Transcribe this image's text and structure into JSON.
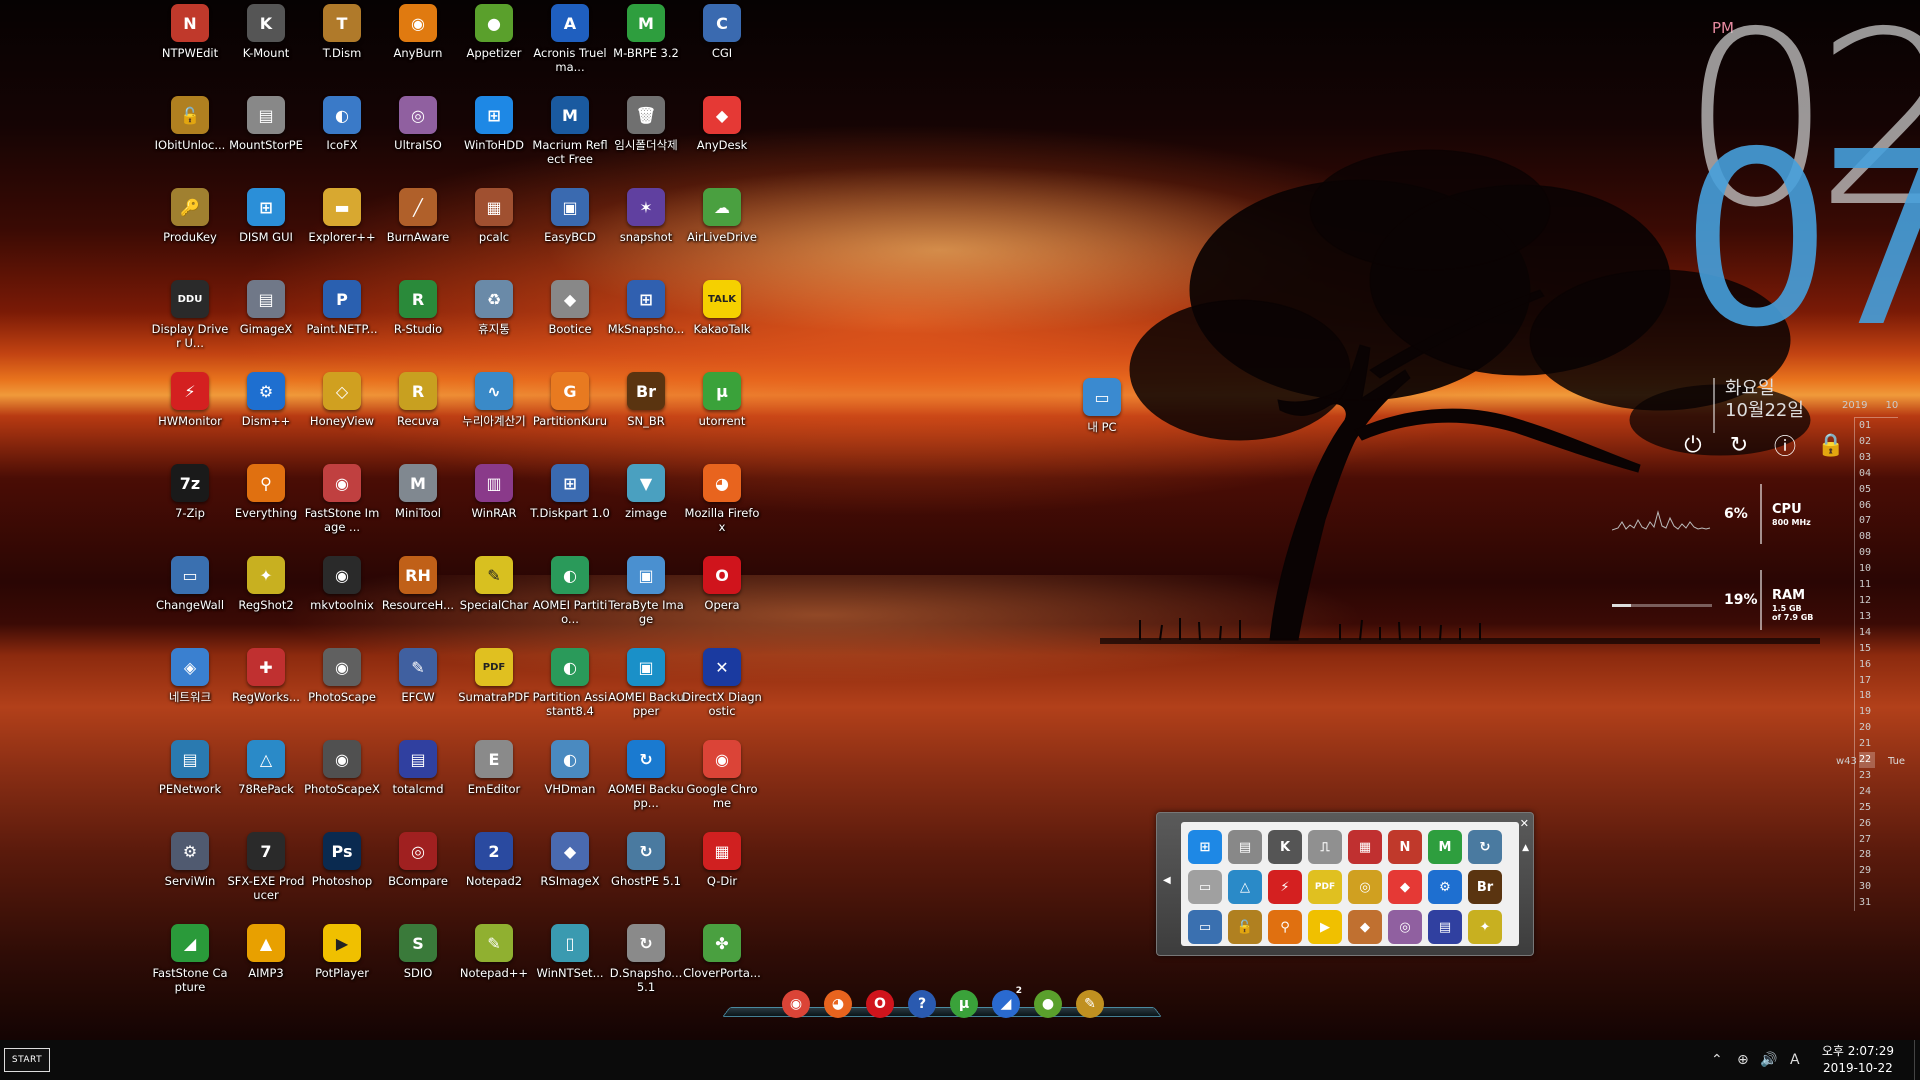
{
  "desktop": {
    "icons": [
      {
        "label": "NTPWEdit",
        "glyph": "N",
        "color": "#c0392b",
        "icon": "ntpwedit-icon"
      },
      {
        "label": "K-Mount",
        "glyph": "K",
        "color": "#555555",
        "icon": "k-mount-icon"
      },
      {
        "label": "T.Dism",
        "glyph": "T",
        "color": "#b07a2a",
        "icon": "tdism-icon"
      },
      {
        "label": "AnyBurn",
        "glyph": "◉",
        "color": "#e07a10",
        "icon": "anyburn-icon"
      },
      {
        "label": "Appetizer",
        "glyph": "●",
        "color": "#5aa02c",
        "icon": "appetizer-icon"
      },
      {
        "label": "Acronis Truelma...",
        "glyph": "A",
        "color": "#1f5fbf",
        "icon": "acronis-icon"
      },
      {
        "label": "M-BRPE 3.2",
        "glyph": "M",
        "color": "#2e9e3e",
        "icon": "mbrpe-icon"
      },
      {
        "label": "CGI",
        "glyph": "C",
        "color": "#3a6ab0",
        "icon": "cgi-icon"
      },
      {
        "label": "IObitUnloc...",
        "glyph": "🔓",
        "color": "#b08020",
        "icon": "iobit-unlocker-icon"
      },
      {
        "label": "MountStorPE",
        "glyph": "▤",
        "color": "#888888",
        "icon": "mountstorpe-icon"
      },
      {
        "label": "IcoFX",
        "glyph": "◐",
        "color": "#3a7ac8",
        "icon": "icofx-icon"
      },
      {
        "label": "UltraISO",
        "glyph": "◎",
        "color": "#9060a0",
        "icon": "ultraiso-icon"
      },
      {
        "label": "WinToHDD",
        "glyph": "⊞",
        "color": "#1e88e5",
        "icon": "wintohdd-icon"
      },
      {
        "label": "Macrium Reflect Free",
        "glyph": "M",
        "color": "#1a5aa0",
        "icon": "macrium-icon"
      },
      {
        "label": "임시폴더삭제",
        "glyph": "🗑",
        "color": "#707070",
        "icon": "trash-icon"
      },
      {
        "label": "AnyDesk",
        "glyph": "◆",
        "color": "#e53935",
        "icon": "anydesk-icon"
      },
      {
        "label": "ProduKey",
        "glyph": "🔑",
        "color": "#a08030",
        "icon": "produkey-icon"
      },
      {
        "label": "DISM GUI",
        "glyph": "⊞",
        "color": "#2b8fd8",
        "icon": "dism-gui-icon"
      },
      {
        "label": "Explorer++",
        "glyph": "▬",
        "color": "#d8a830",
        "icon": "explorer-plus-icon"
      },
      {
        "label": "BurnAware",
        "glyph": "╱",
        "color": "#b0602a",
        "icon": "burnaware-icon"
      },
      {
        "label": "pcalc",
        "glyph": "▦",
        "color": "#a05030",
        "icon": "pcalc-icon"
      },
      {
        "label": "EasyBCD",
        "glyph": "▣",
        "color": "#3a6ab0",
        "icon": "easybcd-icon"
      },
      {
        "label": "snapshot",
        "glyph": "✶",
        "color": "#6040a0",
        "icon": "snapshot-icon"
      },
      {
        "label": "AirLiveDrive",
        "glyph": "☁",
        "color": "#4aa040",
        "icon": "airlivedrive-icon"
      },
      {
        "label": "Display Driver U...",
        "glyph": "DDU",
        "color": "#2a2a2a",
        "icon": "ddu-icon"
      },
      {
        "label": "GimageX",
        "glyph": "▤",
        "color": "#707888",
        "icon": "gimagex-icon"
      },
      {
        "label": "Paint.NETP...",
        "glyph": "P",
        "color": "#2a60b0",
        "icon": "paintnet-icon"
      },
      {
        "label": "R-Studio",
        "glyph": "R",
        "color": "#2a8a3a",
        "icon": "r-studio-icon"
      },
      {
        "label": "휴지통",
        "glyph": "♻",
        "color": "#6a8aa8",
        "icon": "recycle-bin-icon"
      },
      {
        "label": "Bootice",
        "glyph": "◆",
        "color": "#888888",
        "icon": "bootice-icon"
      },
      {
        "label": "MkSnapsho...",
        "glyph": "⊞",
        "color": "#3060b0",
        "icon": "mksnapshot-icon"
      },
      {
        "label": "KakaoTalk",
        "glyph": "TALK",
        "color": "#f5d000",
        "icon": "kakaotalk-icon"
      },
      {
        "label": "HWMonitor",
        "glyph": "⚡",
        "color": "#d42020",
        "icon": "hwmonitor-icon"
      },
      {
        "label": "Dism++",
        "glyph": "⚙",
        "color": "#1e6fd0",
        "icon": "dism-plus-icon"
      },
      {
        "label": "HoneyView",
        "glyph": "◇",
        "color": "#d0a020",
        "icon": "honeyview-icon"
      },
      {
        "label": "Recuva",
        "glyph": "R",
        "color": "#c8a020",
        "icon": "recuva-icon"
      },
      {
        "label": "누리아계산기",
        "glyph": "∿",
        "color": "#3a8ac8",
        "icon": "nuria-calculator-icon"
      },
      {
        "label": "PartitionKuru",
        "glyph": "G",
        "color": "#e87a20",
        "icon": "partitionkuru-icon"
      },
      {
        "label": "SN_BR",
        "glyph": "Br",
        "color": "#5a3410",
        "icon": "bridge-icon"
      },
      {
        "label": "utorrent",
        "glyph": "μ",
        "color": "#3aa23a",
        "icon": "utorrent-icon"
      },
      {
        "label": "7-Zip",
        "glyph": "7z",
        "color": "#1a1a1a",
        "icon": "7zip-icon"
      },
      {
        "label": "Everything",
        "glyph": "⚲",
        "color": "#e07010",
        "icon": "everything-icon"
      },
      {
        "label": "FastStone Image ...",
        "glyph": "◉",
        "color": "#c04040",
        "icon": "faststone-icon"
      },
      {
        "label": "MiniTool",
        "glyph": "M",
        "color": "#808890",
        "icon": "minitool-icon"
      },
      {
        "label": "WinRAR",
        "glyph": "▥",
        "color": "#8a3a8a",
        "icon": "winrar-icon"
      },
      {
        "label": "T.Diskpart 1.0",
        "glyph": "⊞",
        "color": "#3a6ab0",
        "icon": "tdiskpart-icon"
      },
      {
        "label": "zimage",
        "glyph": "▼",
        "color": "#4aa0c0",
        "icon": "zimage-icon"
      },
      {
        "label": "Mozilla Firefox",
        "glyph": "◕",
        "color": "#e8641e",
        "icon": "firefox-icon"
      },
      {
        "label": "ChangeWall",
        "glyph": "▭",
        "color": "#3a70b0",
        "icon": "changewall-icon"
      },
      {
        "label": "RegShot2",
        "glyph": "✦",
        "color": "#c8b020",
        "icon": "regshot-icon"
      },
      {
        "label": "mkvtoolnix",
        "glyph": "◉",
        "color": "#2a2a2a",
        "icon": "mkvtoolnix-icon"
      },
      {
        "label": "ResourceH...",
        "glyph": "RH",
        "color": "#c06018",
        "icon": "resource-hacker-icon"
      },
      {
        "label": "SpecialChar",
        "glyph": "✎",
        "color": "#d8c020",
        "icon": "specialchar-icon"
      },
      {
        "label": "AOMEI Partitio...",
        "glyph": "◐",
        "color": "#2a9a5a",
        "icon": "aomei-partition-icon"
      },
      {
        "label": "TeraByte Image",
        "glyph": "▣",
        "color": "#4a90d0",
        "icon": "terabyte-image-icon"
      },
      {
        "label": "Opera",
        "glyph": "O",
        "color": "#d0141c",
        "icon": "opera-icon"
      },
      {
        "label": "네트워크",
        "glyph": "◈",
        "color": "#3a80d0",
        "icon": "network-icon"
      },
      {
        "label": "RegWorks...",
        "glyph": "✚",
        "color": "#c03030",
        "icon": "regworks-icon"
      },
      {
        "label": "PhotoScape",
        "glyph": "◉",
        "color": "#606060",
        "icon": "photoscape-icon"
      },
      {
        "label": "EFCW",
        "glyph": "✎",
        "color": "#4060a0",
        "icon": "efcw-icon"
      },
      {
        "label": "SumatraPDF",
        "glyph": "PDF",
        "color": "#e0c020",
        "icon": "sumatrapdf-icon"
      },
      {
        "label": "Partition Assistant8.4",
        "glyph": "◐",
        "color": "#2a9a5a",
        "icon": "partition-assistant-icon"
      },
      {
        "label": "AOMEI Backupper",
        "glyph": "▣",
        "color": "#1a90c8",
        "icon": "aomei-backupper-icon"
      },
      {
        "label": "DirectX Diagnostic",
        "glyph": "✕",
        "color": "#1a3aa0",
        "icon": "directx-icon"
      },
      {
        "label": "PENetwork",
        "glyph": "▤",
        "color": "#2a7ab0",
        "icon": "penetwork-icon"
      },
      {
        "label": "78RePack",
        "glyph": "△",
        "color": "#2a8ac8",
        "icon": "78repack-icon"
      },
      {
        "label": "PhotoScapeX",
        "glyph": "◉",
        "color": "#505050",
        "icon": "photoscapex-icon"
      },
      {
        "label": "totalcmd",
        "glyph": "▤",
        "color": "#3040a0",
        "icon": "totalcmd-icon"
      },
      {
        "label": "EmEditor",
        "glyph": "E",
        "color": "#8a8a8a",
        "icon": "emeditor-icon"
      },
      {
        "label": "VHDman",
        "glyph": "◐",
        "color": "#4a8ac0",
        "icon": "vhdman-icon"
      },
      {
        "label": "AOMEI Backupp...",
        "glyph": "↻",
        "color": "#1a7ad0",
        "icon": "aomei-backupper2-icon"
      },
      {
        "label": "Google Chrome",
        "glyph": "◉",
        "color": "#db4437",
        "icon": "chrome-icon"
      },
      {
        "label": "ServiWin",
        "glyph": "⚙",
        "color": "#505a70",
        "icon": "serviwin-icon"
      },
      {
        "label": "SFX-EXE Producer",
        "glyph": "7",
        "color": "#2a2a2a",
        "icon": "sfx-exe-icon"
      },
      {
        "label": "Photoshop",
        "glyph": "Ps",
        "color": "#0a2a50",
        "icon": "photoshop-icon"
      },
      {
        "label": "BCompare",
        "glyph": "◎",
        "color": "#a02020",
        "icon": "bcompare-icon"
      },
      {
        "label": "Notepad2",
        "glyph": "2",
        "color": "#2a4aa0",
        "icon": "notepad2-icon"
      },
      {
        "label": "RSImageX",
        "glyph": "◆",
        "color": "#4a6ab0",
        "icon": "rsimagex-icon"
      },
      {
        "label": "GhostPE 5.1",
        "glyph": "↻",
        "color": "#4a7aa0",
        "icon": "ghostpe-icon"
      },
      {
        "label": "Q-Dir",
        "glyph": "▦",
        "color": "#d02020",
        "icon": "q-dir-icon"
      },
      {
        "label": "FastStone Capture",
        "glyph": "◢",
        "color": "#2a9a3a",
        "icon": "faststone-capture-icon"
      },
      {
        "label": "AIMP3",
        "glyph": "▲",
        "color": "#e8a000",
        "icon": "aimp-icon"
      },
      {
        "label": "PotPlayer",
        "glyph": "▶",
        "color": "#f0c000",
        "icon": "potplayer-icon"
      },
      {
        "label": "SDIO",
        "glyph": "S",
        "color": "#3a7a3a",
        "icon": "sdio-icon"
      },
      {
        "label": "Notepad++",
        "glyph": "✎",
        "color": "#90b030",
        "icon": "notepad-plus-icon"
      },
      {
        "label": "WinNTSet...",
        "glyph": "▯",
        "color": "#3a9ab0",
        "icon": "winntsetup-icon"
      },
      {
        "label": "D.Snapsho... 5.1",
        "glyph": "↻",
        "color": "#8a8a8a",
        "icon": "dsnapshot-icon"
      },
      {
        "label": "CloverPorta...",
        "glyph": "✤",
        "color": "#4aa040",
        "icon": "clover-icon"
      }
    ],
    "mypc": {
      "label": "내 PC",
      "glyph": "▭",
      "color": "#3a8ad0"
    }
  },
  "clock": {
    "ampm": "PM",
    "hour": "02",
    "minute": "07",
    "weekday": "화요일",
    "date": "10월22일"
  },
  "power_buttons": [
    {
      "name": "shutdown-icon",
      "glyph": "⏻"
    },
    {
      "name": "restart-icon",
      "glyph": "↻"
    },
    {
      "name": "logoff-icon",
      "glyph": "ⓘ"
    },
    {
      "name": "lock-icon",
      "glyph": "🔒"
    }
  ],
  "meters": {
    "cpu": {
      "percent": "6%",
      "name": "CPU",
      "sub": "800 MHz",
      "level": 0.06
    },
    "ram": {
      "percent": "19%",
      "name": "RAM",
      "sub1": "1.5 GB",
      "sub2": "of 7.9 GB",
      "level": 0.19
    }
  },
  "calendar": {
    "year": "2019",
    "month": "10",
    "days": [
      "01",
      "02",
      "03",
      "04",
      "05",
      "06",
      "07",
      "08",
      "09",
      "10",
      "11",
      "12",
      "13",
      "14",
      "15",
      "16",
      "17",
      "18",
      "19",
      "20",
      "21",
      "22",
      "23",
      "24",
      "25",
      "26",
      "27",
      "28",
      "29",
      "30",
      "31"
    ],
    "today_index": 21,
    "week": "w43",
    "dow": "Tue"
  },
  "quicklaunch": {
    "items": [
      {
        "icon": "windows-icon",
        "glyph": "⊞",
        "color": "#1e88e5"
      },
      {
        "icon": "mountstorpe-icon",
        "glyph": "▤",
        "color": "#888888"
      },
      {
        "icon": "k-mount-icon",
        "glyph": "K",
        "color": "#555555"
      },
      {
        "icon": "usb-icon",
        "glyph": "⎍",
        "color": "#909090"
      },
      {
        "icon": "partition-icon",
        "glyph": "▦",
        "color": "#c03030"
      },
      {
        "icon": "ntpwedit-icon",
        "glyph": "N",
        "color": "#c0392b"
      },
      {
        "icon": "mbrpe-icon",
        "glyph": "M",
        "color": "#2e9e3e"
      },
      {
        "icon": "ghost-icon",
        "glyph": "↻",
        "color": "#4a7aa0"
      },
      {
        "icon": "drive-icon",
        "glyph": "▭",
        "color": "#a0a0a0"
      },
      {
        "icon": "78repack-icon",
        "glyph": "△",
        "color": "#2a8ac8"
      },
      {
        "icon": "hwmonitor-icon",
        "glyph": "⚡",
        "color": "#d42020"
      },
      {
        "icon": "sumatrapdf-icon",
        "glyph": "PDF",
        "color": "#e0c020"
      },
      {
        "icon": "cd-icon",
        "glyph": "◎",
        "color": "#d0a020"
      },
      {
        "icon": "anydesk-icon",
        "glyph": "◆",
        "color": "#e53935"
      },
      {
        "icon": "dism-plus-icon",
        "glyph": "⚙",
        "color": "#1e6fd0"
      },
      {
        "icon": "bridge-icon",
        "glyph": "Br",
        "color": "#5a3410"
      },
      {
        "icon": "changewall-icon",
        "glyph": "▭",
        "color": "#3a70b0"
      },
      {
        "icon": "iobit-unlocker-icon",
        "glyph": "🔓",
        "color": "#b08020"
      },
      {
        "icon": "everything-icon",
        "glyph": "⚲",
        "color": "#e07010"
      },
      {
        "icon": "potplayer-icon",
        "glyph": "▶",
        "color": "#f0c000"
      },
      {
        "icon": "box-icon",
        "glyph": "◆",
        "color": "#c07030"
      },
      {
        "icon": "ultraiso-icon",
        "glyph": "◎",
        "color": "#9060a0"
      },
      {
        "icon": "totalcmd-icon",
        "glyph": "▤",
        "color": "#3040a0"
      },
      {
        "icon": "regshot-icon",
        "glyph": "✦",
        "color": "#c8b020"
      }
    ]
  },
  "dock": {
    "items": [
      {
        "icon": "chrome-icon",
        "glyph": "◉",
        "color": "#db4437"
      },
      {
        "icon": "firefox-icon",
        "glyph": "◕",
        "color": "#e8641e"
      },
      {
        "icon": "opera-icon",
        "glyph": "O",
        "color": "#d0141c"
      },
      {
        "icon": "help-icon",
        "glyph": "?",
        "color": "#2a5ab0"
      },
      {
        "icon": "utorrent-icon",
        "glyph": "μ",
        "color": "#3aa23a"
      },
      {
        "icon": "network-signal-icon",
        "glyph": "◢",
        "color": "#2a6ad0"
      },
      {
        "icon": "appetizer-icon",
        "glyph": "●",
        "color": "#5aa02c"
      },
      {
        "icon": "pencil-icon",
        "glyph": "✎",
        "color": "#c09020"
      }
    ],
    "badge": "2"
  },
  "taskbar": {
    "start_label": "START",
    "tray_icons": [
      {
        "icon": "chevron-up-icon",
        "glyph": "⌃"
      },
      {
        "icon": "globe-icon",
        "glyph": "⊕"
      },
      {
        "icon": "speaker-icon",
        "glyph": "🔊"
      },
      {
        "icon": "ime-icon",
        "glyph": "A"
      }
    ],
    "time": "오후 2:07:29",
    "date": "2019-10-22"
  }
}
